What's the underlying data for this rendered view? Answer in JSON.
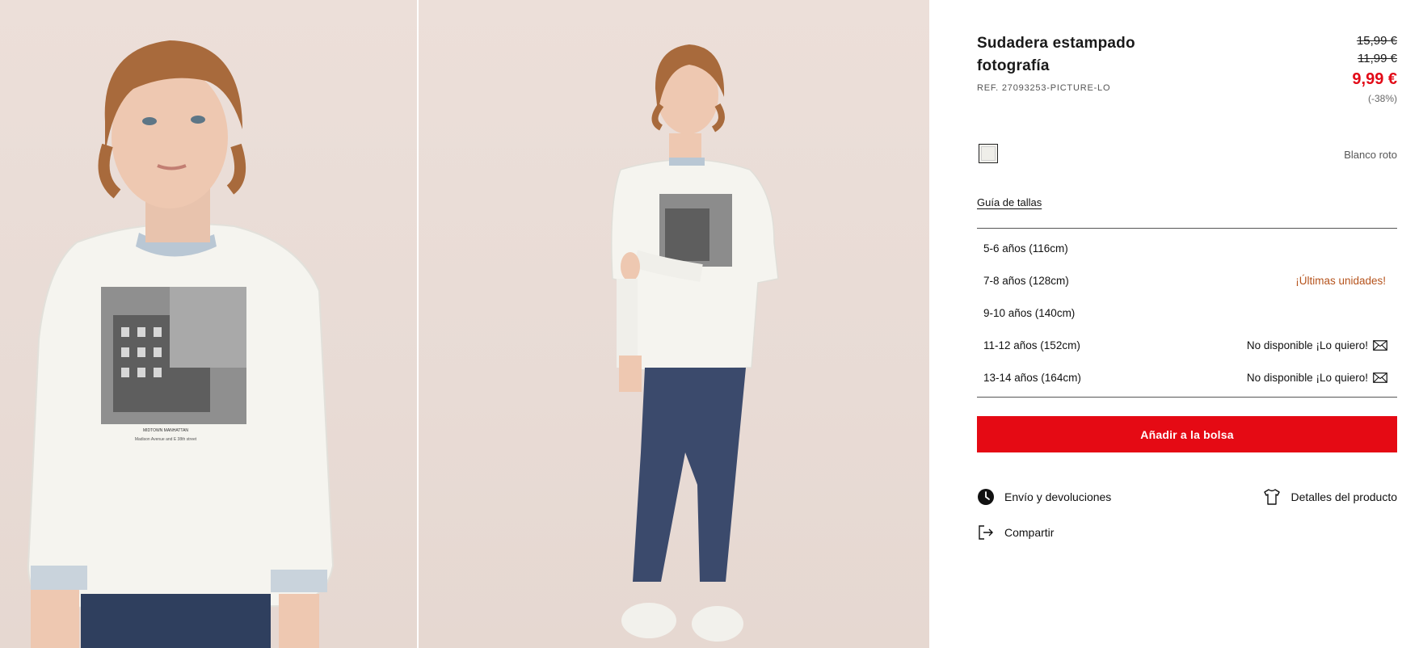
{
  "product": {
    "title": "Sudadera estampado fotografía",
    "ref": "REF. 27093253-PICTURE-LO",
    "price_original": "15,99 €",
    "price_previous": "11,99 €",
    "price_current": "9,99 €",
    "discount": "(-38%)",
    "color_name": "Blanco roto"
  },
  "size_guide_label": "Guía de tallas",
  "sizes": [
    {
      "label": "5-6 años (116cm)",
      "note": ""
    },
    {
      "label": "7-8 años (128cm)",
      "note": "¡Últimas unidades!"
    },
    {
      "label": "9-10 años (140cm)",
      "note": ""
    },
    {
      "label": "11-12 años (152cm)",
      "note": "No disponible ¡Lo quiero!"
    },
    {
      "label": "13-14 años (164cm)",
      "note": "No disponible ¡Lo quiero!"
    }
  ],
  "actions": {
    "add_to_bag": "Añadir a la bolsa",
    "shipping": "Envío y devoluciones",
    "details": "Detalles del producto",
    "share": "Compartir"
  },
  "print_text": {
    "line1": "MIDTOWN MANHATTAN",
    "line2": "Madison Avenue and E 38th street"
  },
  "colors": {
    "accent_red": "#e50a14",
    "price_red": "#e20a17",
    "warning_orange": "#b5531c"
  },
  "icons": {
    "shipping": "clock-icon",
    "details": "tshirt-icon",
    "share": "share-icon",
    "notify": "mail-icon"
  }
}
